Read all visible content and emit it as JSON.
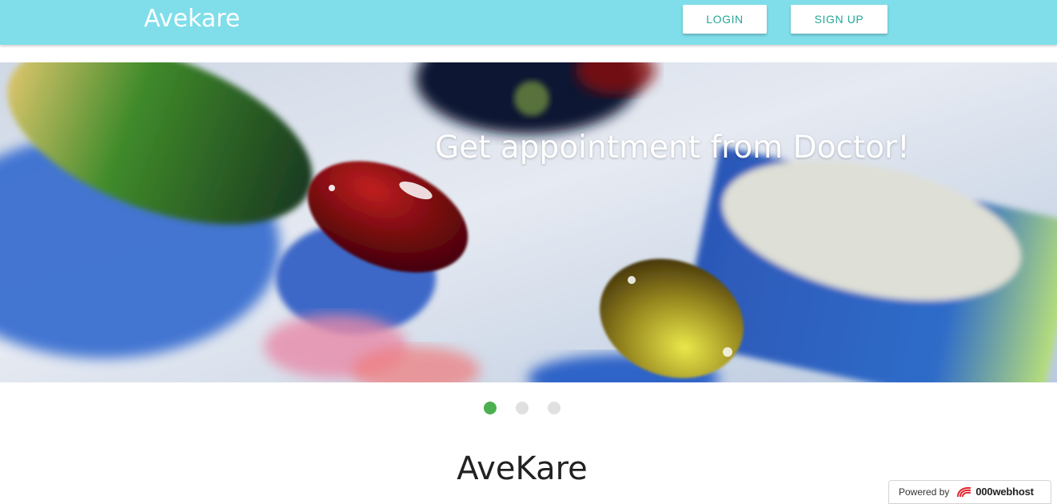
{
  "navbar": {
    "brand": "Avekare",
    "login_label": "LOGIN",
    "signup_label": "SIGN UP",
    "background_color": "#7fdeea"
  },
  "slider": {
    "caption": "Get appointment from Doctor!",
    "slide_count": 3,
    "active_index": 0,
    "active_color": "#4caf50",
    "inactive_color": "#e0e0e0"
  },
  "main": {
    "title": "AveKare"
  },
  "badge": {
    "powered_label": "Powered by",
    "host_name": "000webhost",
    "icon": "000webhost-logo-icon"
  }
}
